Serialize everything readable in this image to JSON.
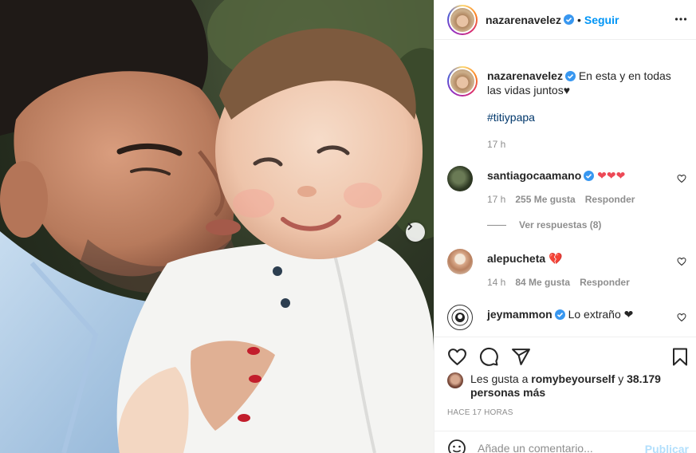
{
  "post": {
    "author": "nazarenavelez",
    "follow_label": "Seguir",
    "dot": "•",
    "caption": "En esta y en todas las vidas juntos♥",
    "hashtag": "#titiypapa",
    "caption_time": "17 h"
  },
  "comments": [
    {
      "user": "santiagocaamano",
      "text": "❤❤❤",
      "time": "17 h",
      "likes": "255 Me gusta",
      "reply": "Responder",
      "avatar": "santi"
    },
    {
      "user": "alepucheta",
      "text": "💔",
      "time": "14 h",
      "likes": "84 Me gusta",
      "reply": "Responder",
      "avatar": "ale"
    },
    {
      "user": "jeymammon",
      "text": "Lo extraño ❤",
      "avatar": "jey"
    }
  ],
  "view_replies": "Ver respuestas (8)",
  "likes": {
    "prefix": "Les gusta a",
    "user": "romybeyourself",
    "conjunction": "y",
    "others": "38.179 personas más"
  },
  "time_ago": "HACE 17 HORAS",
  "comment_box": {
    "placeholder": "Añade un comentario...",
    "publish_label": "Publicar"
  },
  "colors": {
    "link_blue": "#0095f6",
    "verified_blue": "#3897f0",
    "heart_red": "#ed4956",
    "muted": "#8e8e8e"
  },
  "icons": [
    "verified-icon",
    "more-options-icon",
    "heart-icon",
    "comment-icon",
    "share-icon",
    "bookmark-icon",
    "emoji-icon",
    "chevron-right-icon"
  ]
}
